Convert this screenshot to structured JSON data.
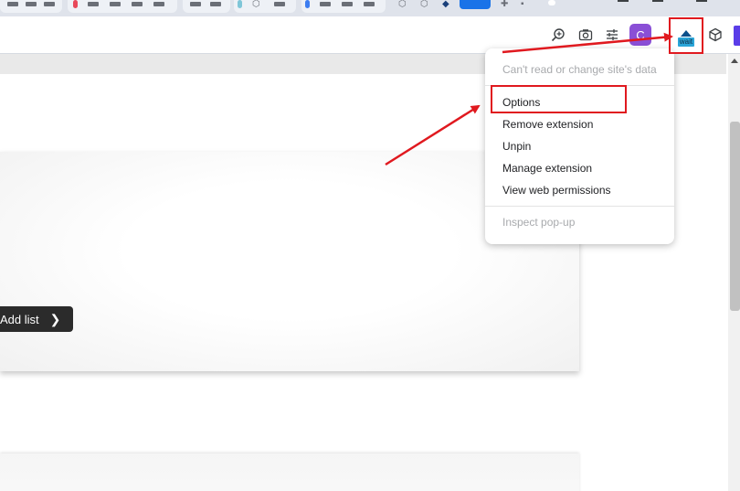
{
  "toolbar": {
    "avatar_letter": "C",
    "extension_label": "wait",
    "icons": [
      "zoom-in-icon",
      "camera-icon",
      "tune-icon",
      "cube-icon"
    ]
  },
  "page": {
    "add_list_label": "Add list"
  },
  "context_menu": {
    "header": "Can't read or change site's data",
    "items": [
      {
        "label": "Options"
      },
      {
        "label": "Remove extension"
      },
      {
        "label": "Unpin"
      },
      {
        "label": "Manage extension"
      },
      {
        "label": "View web permissions"
      }
    ],
    "footer": "Inspect pop-up"
  },
  "colors": {
    "annotation": "#e0191f",
    "avatar": "#8a4fd6",
    "accent": "#1a73e8"
  }
}
